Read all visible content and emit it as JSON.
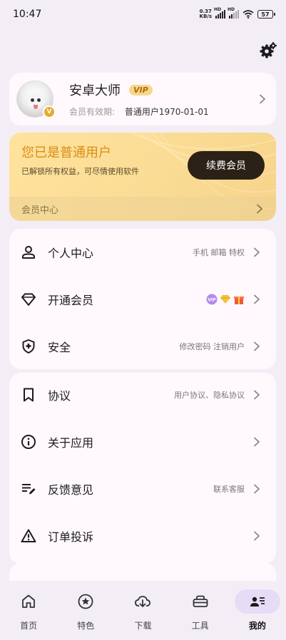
{
  "status_bar": {
    "time": "10:47",
    "net_speed_value": "0.37",
    "net_speed_unit": "KB/s",
    "sim1_tag": "HD",
    "sim2_tag": "HD",
    "battery": "57"
  },
  "profile": {
    "name": "安卓大师",
    "vip_tag": "VIP",
    "avatar_badge": "V",
    "expire_label": "会员有效期:",
    "expire_value": "普通用户1970-01-01"
  },
  "membership": {
    "title": "您已是普通用户",
    "subtitle": "已解锁所有权益，可尽情使用软件",
    "renew_button": "续费会员",
    "center_link": "会员中心"
  },
  "menu": {
    "personal": {
      "label": "个人中心",
      "hint": "手机 邮箱 特权",
      "icon": "person-icon"
    },
    "vip": {
      "label": "开通会员",
      "icon": "diamond-icon",
      "hint_icons": [
        "vip-badge-icon",
        "gold-diamond-icon",
        "gift-icon"
      ]
    },
    "security": {
      "label": "安全",
      "hint": "修改密码  注销用户",
      "icon": "shield-icon"
    },
    "agreement": {
      "label": "协议",
      "hint": "用户协议、隐私协议",
      "icon": "bookmark-icon"
    },
    "about": {
      "label": "关于应用",
      "icon": "info-icon"
    },
    "feedback": {
      "label": "反馈意见",
      "hint": "联系客服",
      "icon": "edit-list-icon"
    },
    "complaint": {
      "label": "订单投诉",
      "icon": "warning-icon"
    }
  },
  "nav": {
    "home": "首页",
    "featured": "特色",
    "download": "下载",
    "tools": "工具",
    "mine": "我的",
    "active": "mine"
  },
  "colors": {
    "accent_gold": "#d98d13",
    "renew_button_bg": "#2b2117",
    "card_bg": "#fff9fd",
    "page_bg": "#f3eef6",
    "nav_active_pill": "#e7dcf5"
  }
}
